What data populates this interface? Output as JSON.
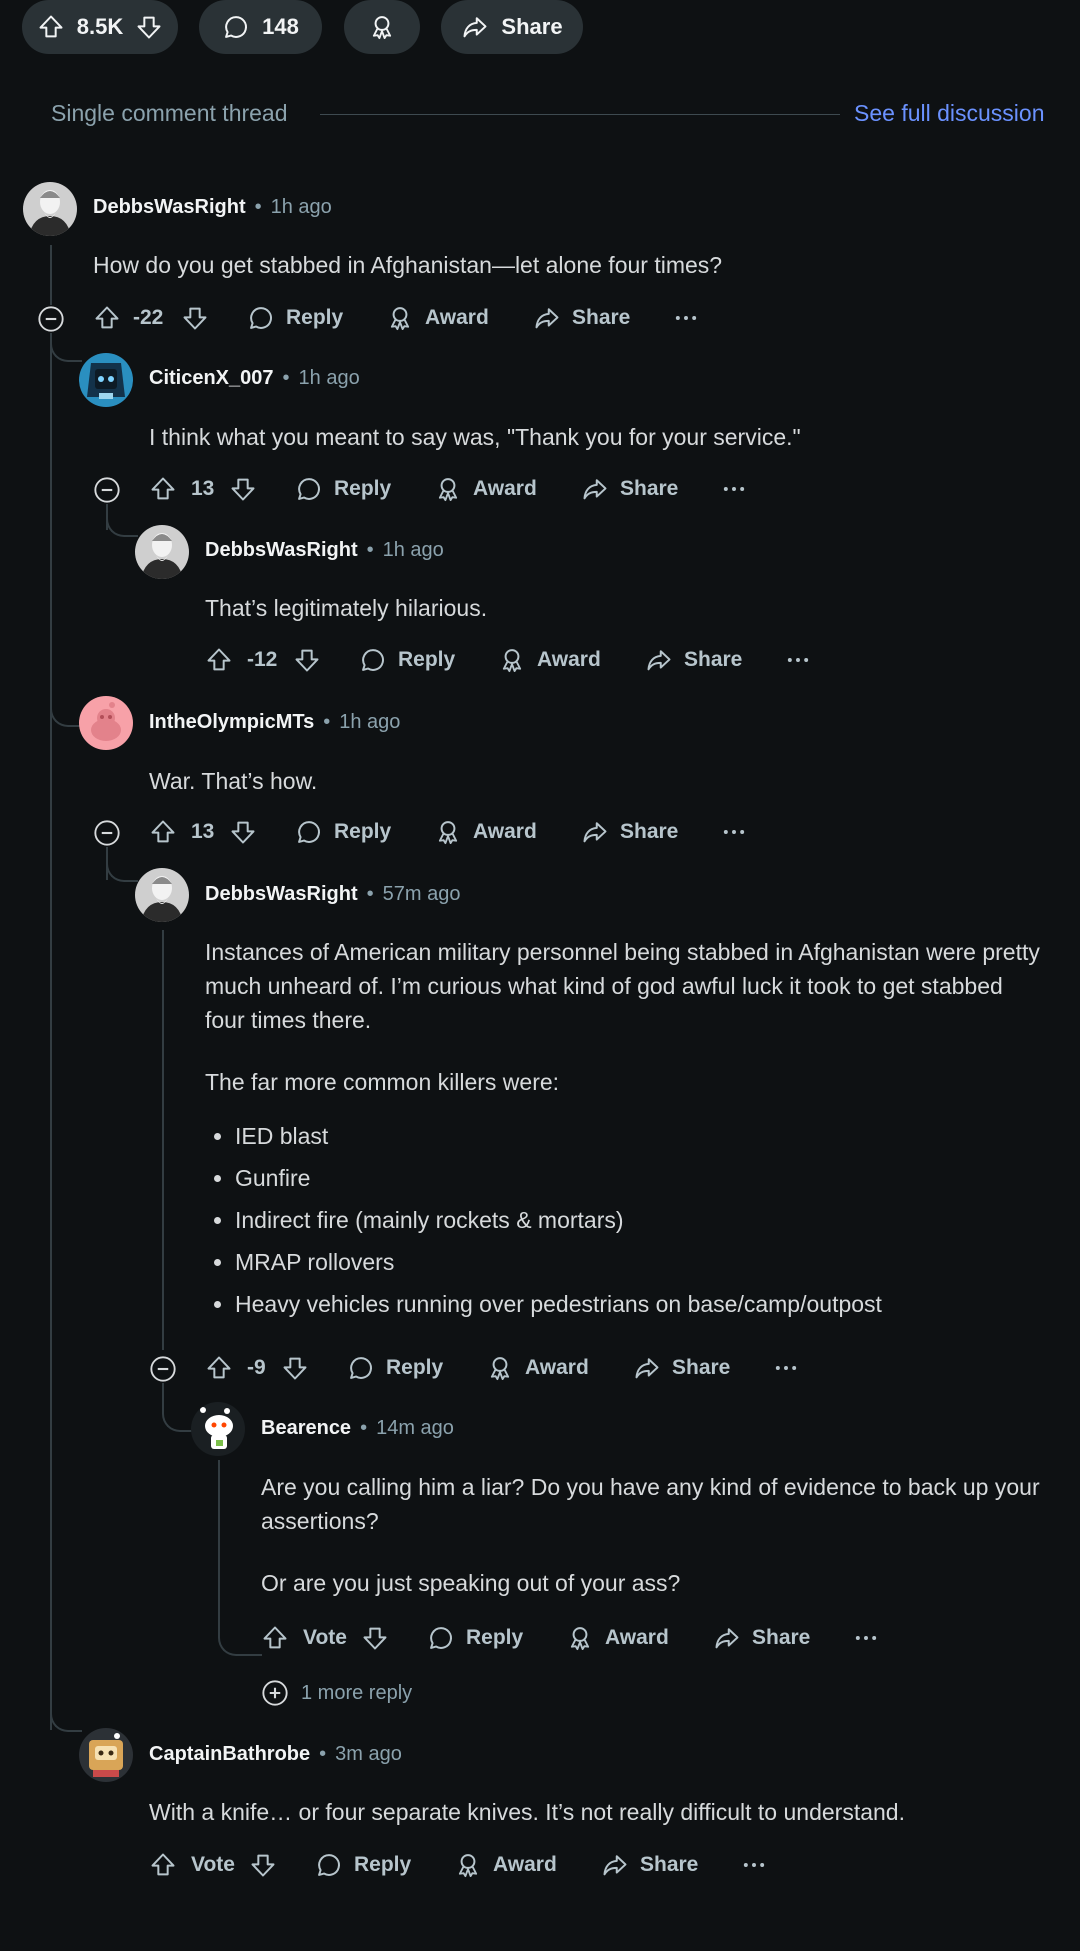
{
  "post_bar": {
    "vote_count": "8.5K",
    "comment_count": "148",
    "share_label": "Share"
  },
  "thread": {
    "label": "Single comment thread",
    "full_link": "See full discussion"
  },
  "comments": [
    {
      "user": "DebbsWasRight",
      "time": "1h ago",
      "text": "How do you get stabbed in Afghanistan—let alone four times?",
      "votes": "-22",
      "reply": "Reply",
      "award": "Award",
      "share": "Share"
    },
    {
      "user": "CiticenX_007",
      "time": "1h ago",
      "text": "I think what you meant to say was, \"Thank you for your service.\"",
      "votes": "13",
      "reply": "Reply",
      "award": "Award",
      "share": "Share"
    },
    {
      "user": "DebbsWasRight",
      "time": "1h ago",
      "text": "That’s legitimately hilarious.",
      "votes": "-12",
      "reply": "Reply",
      "award": "Award",
      "share": "Share"
    },
    {
      "user": "IntheOlympicMTs",
      "time": "1h ago",
      "text": "War. That’s how.",
      "votes": "13",
      "reply": "Reply",
      "award": "Award",
      "share": "Share"
    },
    {
      "user": "DebbsWasRight",
      "time": "57m ago",
      "para1": "Instances of American military personnel being stabbed in Afghanistan were pretty much unheard of. I’m curious what kind of god awful luck it took to get stabbed four times there.",
      "para2": "The far more common killers were:",
      "list": [
        "IED blast",
        "Gunfire",
        "Indirect fire (mainly rockets & mortars)",
        "MRAP rollovers",
        "Heavy vehicles running over pedestrians on base/camp/outpost"
      ],
      "votes": "-9",
      "reply": "Reply",
      "award": "Award",
      "share": "Share"
    },
    {
      "user": "Bearence",
      "time": "14m ago",
      "para1": "Are you calling him a liar? Do you have any kind of evidence to back up your assertions?",
      "para2": "Or are you just speaking out of your ass?",
      "votes": "Vote",
      "reply": "Reply",
      "award": "Award",
      "share": "Share",
      "more_replies": "1 more reply"
    },
    {
      "user": "CaptainBathrobe",
      "time": "3m ago",
      "text": "With a knife… or four separate knives. It’s not really difficult to understand.",
      "votes": "Vote",
      "reply": "Reply",
      "award": "Award",
      "share": "Share"
    }
  ],
  "colors": {
    "background": "#0e1113",
    "pill": "#2a3236",
    "link": "#6b92ff",
    "muted": "#8ba2ad",
    "line": "#333d42"
  }
}
